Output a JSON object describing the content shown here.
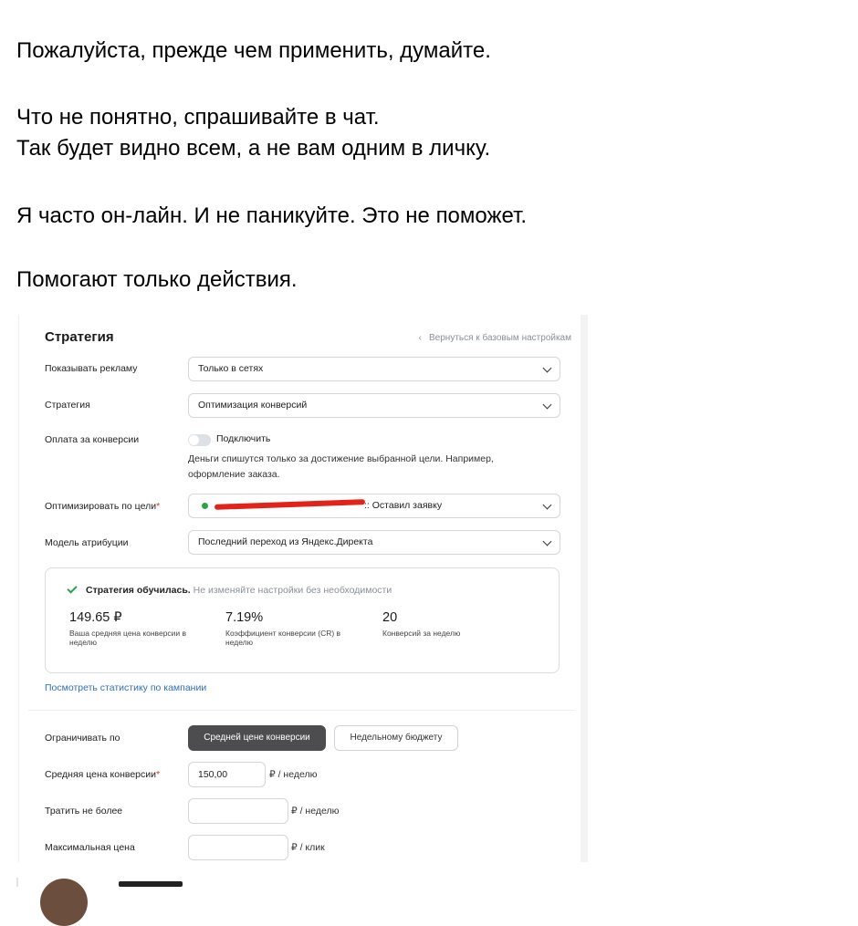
{
  "message": {
    "line1": "Пожалуйста, прежде чем применить, думайте.",
    "line2": "Что не понятно, спрашивайте в чат.",
    "line3": "Так будет видно всем, а не вам одним в личку.",
    "line4": "Я часто он-лайн. И не паникуйте. Это не поможет.",
    "line5": "Помогают только действия."
  },
  "strategy": {
    "title": "Стратегия",
    "back_link": "Вернуться к базовым настройкам",
    "show_ads_label": "Показывать рекламу",
    "show_ads_value": "Только в сетях",
    "strategy_label": "Стратегия",
    "strategy_value": "Оптимизация конверсий",
    "pay_label": "Оплата за конверсии",
    "pay_toggle_label": "Подключить",
    "pay_hint": "Деньги спишутся только за достижение выбранной цели. Например, оформление заказа.",
    "goal_label": "Оптимизировать по цели",
    "goal_value": ":: Оставил заявку",
    "attribution_label": "Модель атрибуции",
    "attribution_value": "Последний переход из Яндекс.Директа"
  },
  "stats": {
    "status_bold": "Стратегия обучилась.",
    "status_rest": "Не изменяйте настройки без необходимости",
    "items": [
      {
        "value": "149.65 ₽",
        "caption": "Ваша средняя цена конверсии в неделю"
      },
      {
        "value": "7.19%",
        "caption": "Коэффициент конверсии (CR) в неделю"
      },
      {
        "value": "20",
        "caption": "Конверсий за неделю"
      }
    ],
    "link": "Посмотреть статистику по кампании"
  },
  "limits": {
    "limit_label": "Ограничивать по",
    "btn_avg": "Средней цене конверсии",
    "btn_weekly": "Недельному бюджету",
    "avg_cost_label": "Средняя цена конверсии",
    "avg_cost_value": "150,00",
    "avg_cost_unit": "₽ / неделю",
    "spend_label": "Тратить не более",
    "spend_unit": "₽ / неделю",
    "max_price_label": "Максимальная цена",
    "max_price_unit": "₽ / клик"
  },
  "colors": {
    "accent_link": "#2f6fbf",
    "success": "#2aa44a",
    "required": "#e0321c",
    "active_button": "#4d4d4f"
  }
}
